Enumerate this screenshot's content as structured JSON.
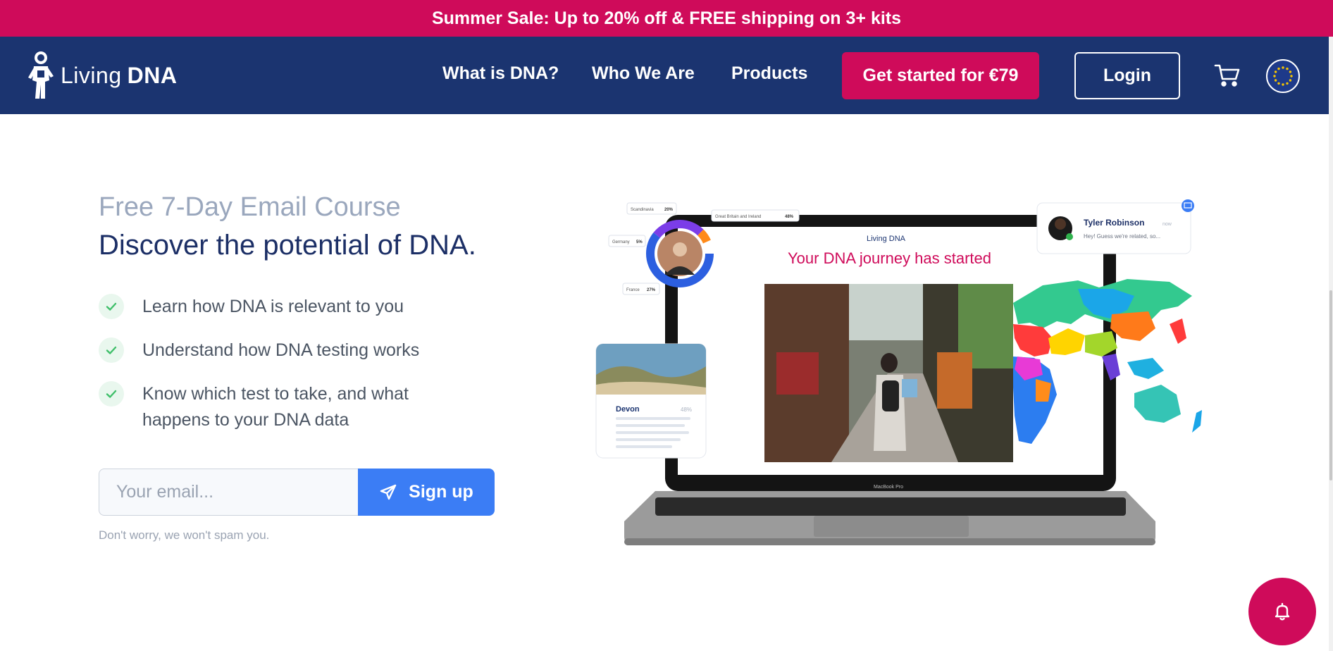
{
  "banner": {
    "text": "Summer Sale: Up to 20% off & FREE shipping on 3+ kits"
  },
  "header": {
    "logo_word1": "Living",
    "logo_word2": "DNA",
    "nav": [
      "What is DNA?",
      "Who We Are",
      "Products"
    ],
    "cta_label": "Get started for €79",
    "login_label": "Login",
    "icons": {
      "cart": "cart-icon",
      "region": "eu-flag-icon"
    }
  },
  "main": {
    "kicker": "Free 7-Day Email Course",
    "headline": "Discover the potential of DNA.",
    "checklist": [
      "Learn how DNA is relevant to you",
      "Understand how DNA testing works",
      "Know which test to take, and what happens to your DNA data"
    ],
    "email_placeholder": "Your email...",
    "signup_label": "Sign up",
    "note": "Don't worry, we won't spam you."
  },
  "hero": {
    "screen_logo": "Living DNA",
    "screen_title": "Your DNA journey has started",
    "laptop_model": "MacBook Pro",
    "ancestry_labels": [
      {
        "name": "Scandinavia",
        "pct": "20%"
      },
      {
        "name": "Great Britain and Ireland",
        "pct": "48%"
      },
      {
        "name": "Germany",
        "pct": "5%"
      },
      {
        "name": "France",
        "pct": "27%"
      }
    ],
    "message_card": {
      "name": "Tyler Robinson",
      "time": "now",
      "message": "Hey! Guess we're related, so..."
    },
    "location_card": {
      "title": "Devon",
      "tag": "48%"
    }
  },
  "colors": {
    "banner": "#cf0b5a",
    "nav": "#1b3470",
    "accent": "#cf0b5a",
    "signup": "#3b7df5",
    "headline": "#1c2f66"
  },
  "fab": {
    "icon": "bell-icon"
  }
}
